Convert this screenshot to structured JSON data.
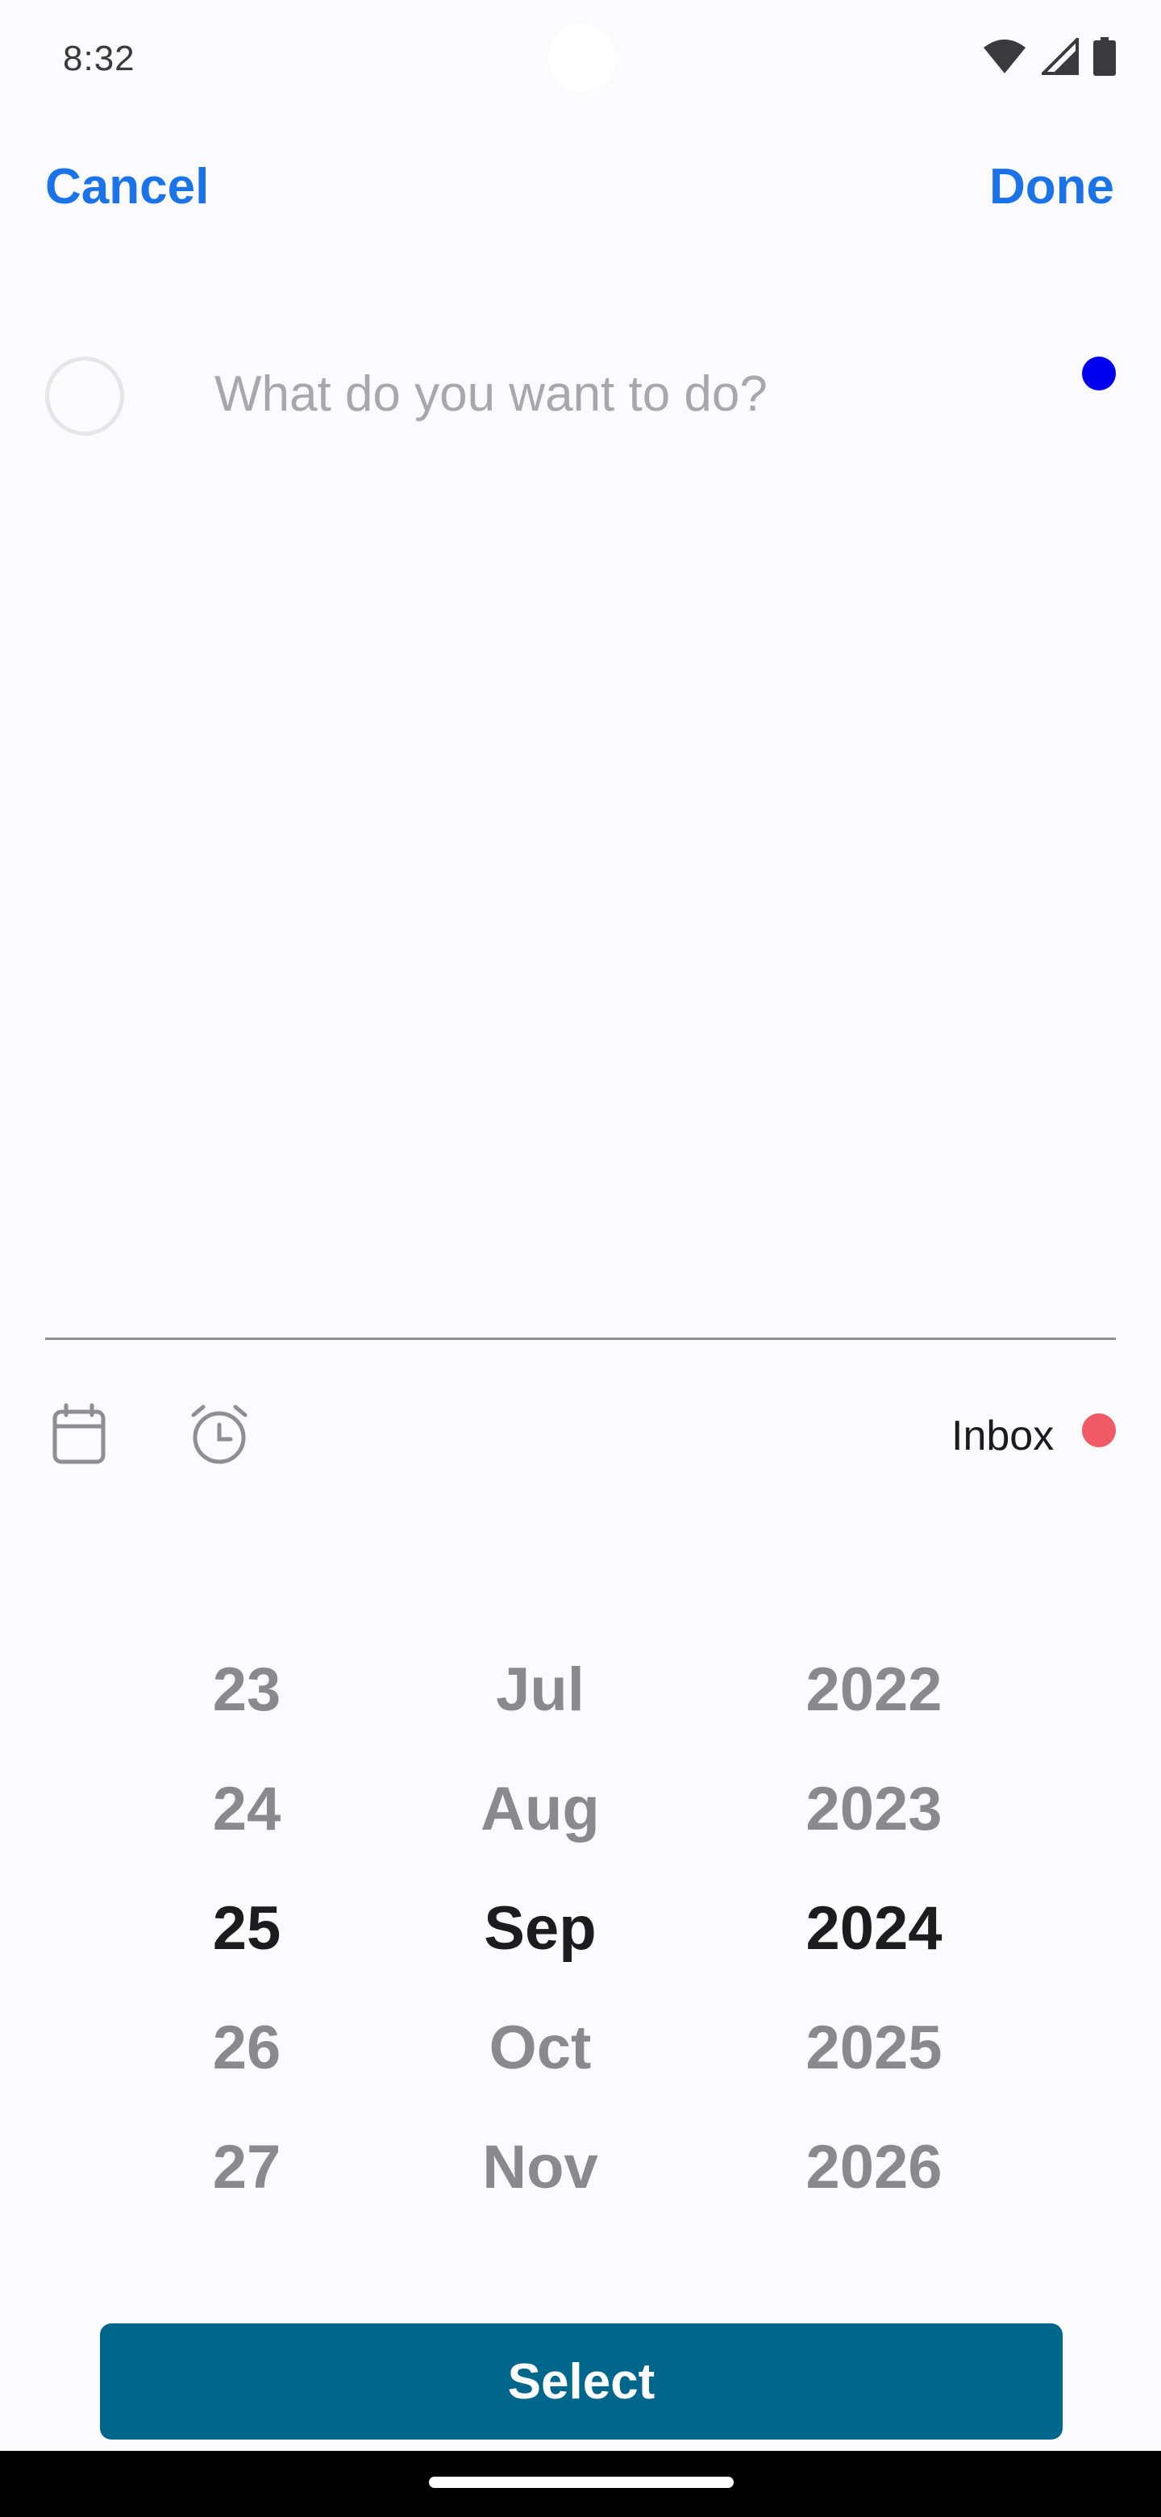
{
  "status_bar": {
    "time": "8:32",
    "icons": [
      "wifi-icon",
      "signal-icon",
      "battery-icon"
    ]
  },
  "nav": {
    "cancel_label": "Cancel",
    "done_label": "Done",
    "accent_color": "#1a73e8"
  },
  "task": {
    "placeholder": "What do you want to do?",
    "value": "",
    "priority_color": "#0000ee"
  },
  "toolbar": {
    "icons": [
      "calendar-icon",
      "alarm-clock-icon"
    ],
    "list_label": "Inbox",
    "list_color": "#f05a67"
  },
  "date_picker": {
    "days": [
      "23",
      "24",
      "25",
      "26",
      "27"
    ],
    "months": [
      "Jul",
      "Aug",
      "Sep",
      "Oct",
      "Nov"
    ],
    "years": [
      "2022",
      "2023",
      "2024",
      "2025",
      "2026"
    ],
    "selected": {
      "day": "25",
      "month": "Sep",
      "year": "2024"
    },
    "select_label": "Select",
    "button_color": "#00668c"
  }
}
